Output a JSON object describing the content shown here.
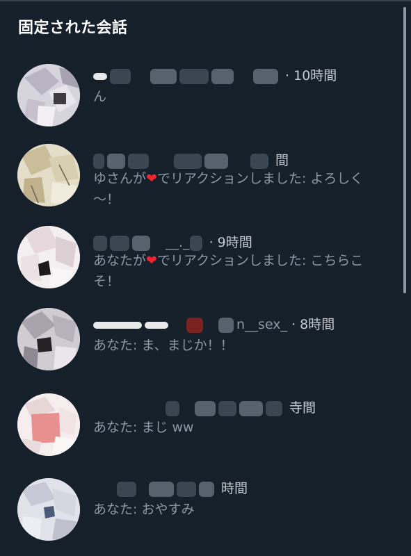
{
  "header": {
    "title": "固定された会話"
  },
  "conversations": [
    {
      "time_suffix": "· 10時間",
      "preview_text": "ん"
    },
    {
      "time_suffix": "間",
      "preview_before": "ゆさんが",
      "reaction_icon": "heart-icon",
      "preview_after": "でリアクションしました: よろしく～！"
    },
    {
      "name_fragment": "__._",
      "time_suffix": "· 9時間",
      "preview_before": "あなたが",
      "reaction_icon": "heart-icon",
      "preview_after": "でリアクションしました: こちらこそ！"
    },
    {
      "name_fragment": "n__sex_",
      "time_suffix": "· 8時間",
      "preview_text": "あなた: ま、まじか！！"
    },
    {
      "time_suffix": "寺間",
      "preview_text": "あなた: まじ ww"
    },
    {
      "time_suffix": "時間",
      "preview_text": "あなた: おやすみ"
    }
  ],
  "colors": {
    "background": "#15202b",
    "text_primary": "#ffffff",
    "text_secondary": "#8b98a5",
    "heart": "#f4212e"
  }
}
